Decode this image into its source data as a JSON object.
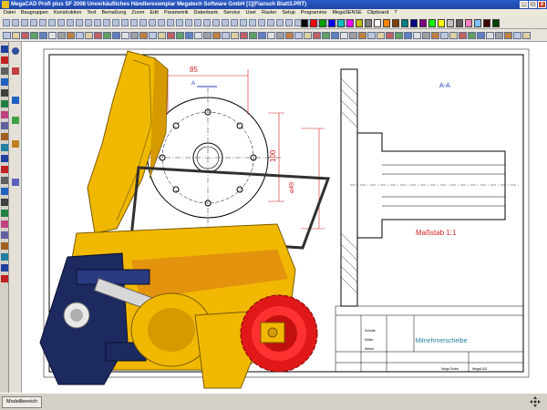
{
  "window": {
    "title": "MegaCAD Profi plus SF 2008 Unverkäufliches Händlerexemplar Megatech Software GmbH [1](Flansch Blatt3.PRT)"
  },
  "menu": {
    "items": [
      "Datei",
      "Baugruppen",
      "Konstruktion",
      "Text",
      "Bemaßung",
      "Zoom",
      "Edit",
      "Parametrik",
      "Datenbank",
      "Service",
      "User",
      "Raster",
      "Setup",
      "Programme",
      "MegaSENSE",
      "Clipboard",
      "?"
    ]
  },
  "drawing": {
    "dim_top": "85",
    "dim_right": "100",
    "dim_left": "⌀49",
    "section_marker": "A",
    "section_label": "A-A",
    "scale_label": "Maßstab 1:1",
    "title_block_name": "Mitnehmerscheibe",
    "names": [
      "Schulte",
      "Müller",
      "Weber"
    ],
    "company": "Mega Gmbh",
    "company2": "MegaCAD"
  },
  "status": {
    "tab_label": "Modellbereich"
  },
  "colors": {
    "dimension_red": "#d02020",
    "titlebar_blue": "#1e46a8",
    "part_yellow": "#f0b800"
  },
  "icons": [
    "app-icon",
    "minimize-icon",
    "maximize-icon",
    "close-icon",
    "pan-icon"
  ]
}
